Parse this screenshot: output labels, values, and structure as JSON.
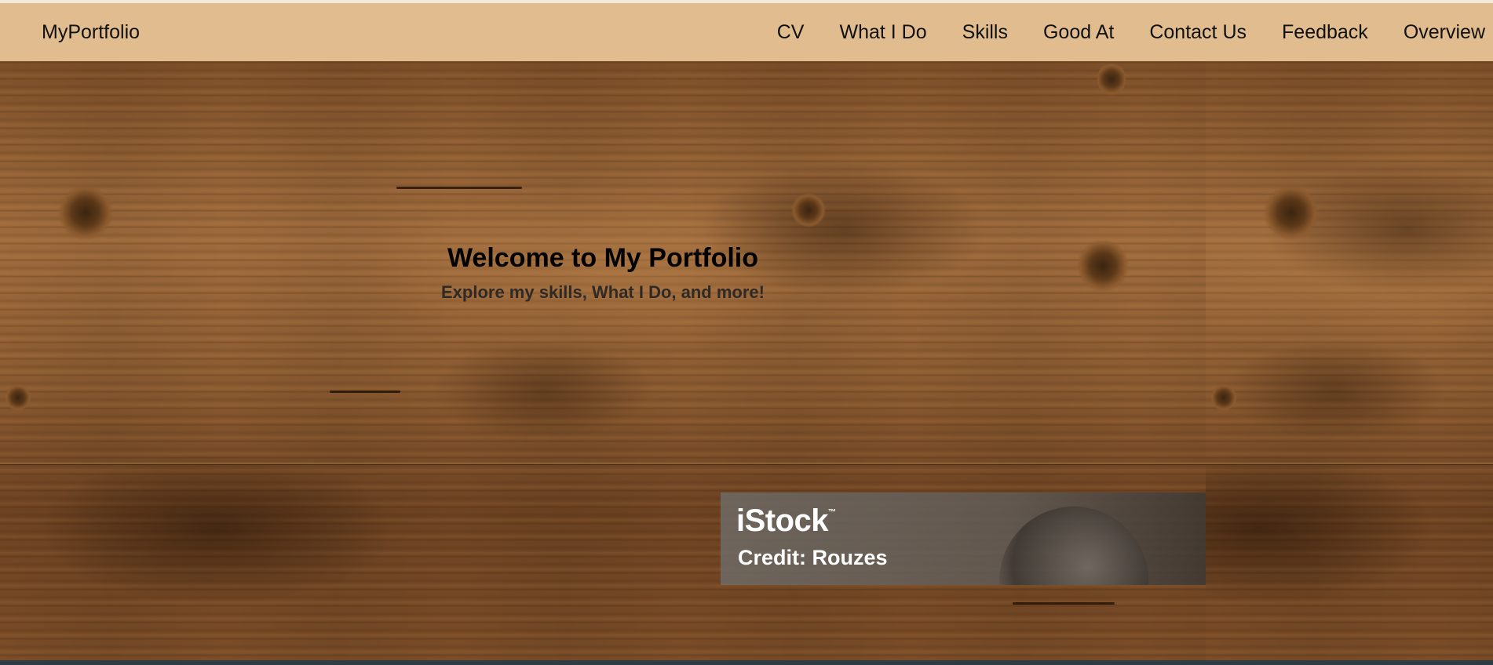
{
  "navbar": {
    "brand": "MyPortfolio",
    "links": [
      {
        "label": "CV"
      },
      {
        "label": "What I Do"
      },
      {
        "label": "Skills"
      },
      {
        "label": "Good At"
      },
      {
        "label": "Contact Us"
      },
      {
        "label": "Feedback"
      },
      {
        "label": "Overview"
      }
    ]
  },
  "hero": {
    "title": "Welcome to My Portfolio",
    "subtitle": "Explore my skills, What I Do, and more!"
  },
  "watermark": {
    "logo": "iStock",
    "tm": "™",
    "credit": "Credit: Rouzes"
  },
  "colors": {
    "navbar_bg": "#e0bc8f",
    "text": "#111111",
    "footer_strip": "#2f3c44"
  }
}
